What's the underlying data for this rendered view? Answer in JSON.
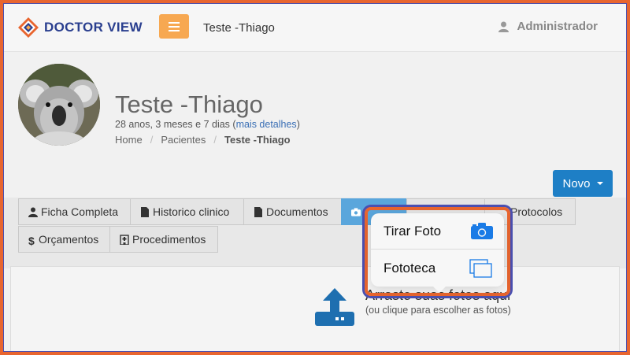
{
  "header": {
    "brand": "DOCTOR VIEW",
    "title": "Teste -Thiago",
    "user": "Administrador"
  },
  "patient": {
    "name": "Teste -Thiago",
    "age_text": "28 anos, 3 meses e 7 dias (",
    "details_link": "mais detalhes",
    "age_close": ")"
  },
  "breadcrumb": [
    "Home",
    "Pacientes",
    "Teste -Thiago"
  ],
  "novo_button": "Novo",
  "tabs": [
    {
      "label": "Ficha Completa",
      "icon": "user-icon"
    },
    {
      "label": "Historico clinico",
      "icon": "file-icon"
    },
    {
      "label": "Documentos",
      "icon": "file-icon"
    },
    {
      "label": "",
      "icon": "camera-icon"
    },
    {
      "label": "",
      "icon": ""
    },
    {
      "label": "Protocolos",
      "icon": ""
    },
    {
      "label": "Orçamentos",
      "icon": "dollar-icon"
    },
    {
      "label": "Procedimentos",
      "icon": "hospital-icon"
    }
  ],
  "popover": {
    "take_photo": "Tirar Foto",
    "library": "Fototeca"
  },
  "dropzone": {
    "title": "Arraste suas fotos aqui",
    "subtitle": "(ou clique para escolher as fotos)"
  },
  "colors": {
    "brand_blue": "#2a3f8f",
    "menu_orange": "#f7a851",
    "primary_blue": "#1e7fc6",
    "tab_active": "#5aa6dc",
    "highlight_orange": "#e8652f",
    "highlight_purple": "#4a4fb0"
  }
}
